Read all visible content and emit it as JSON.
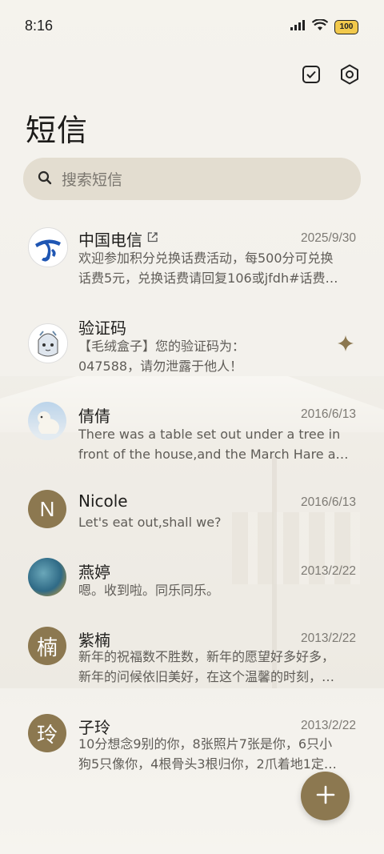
{
  "status_bar": {
    "time": "8:16",
    "battery": "100"
  },
  "header": {
    "title": "短信"
  },
  "search": {
    "placeholder": "搜索短信"
  },
  "conversations": [
    {
      "name": "中国电信",
      "date": "2025/9/30",
      "line1": "欢迎参加积分兑换话费活动，每500分可兑换",
      "line2": "话费5元，兑换话费请回复106或jfdh#话费…"
    },
    {
      "name": "验证码",
      "date": "",
      "line1": "【毛绒盒子】您的验证码为：",
      "line2": "047588，请勿泄露于他人！"
    },
    {
      "name": "倩倩",
      "date": "2016/6/13",
      "line1": "There was a table set out under a tree in",
      "line2": "front of the house,and the March Hare an…"
    },
    {
      "name": "Nicole",
      "date": "2016/6/13",
      "avatar_letter": "N",
      "line1": "Let's eat out,shall we?"
    },
    {
      "name": "燕婷",
      "date": "2013/2/22",
      "line1": "嗯。收到啦。同乐同乐。"
    },
    {
      "name": "紫楠",
      "date": "2013/2/22",
      "avatar_letter": "楠",
      "line1": "新年的祝福数不胜数，新年的愿望好多好多，",
      "line2": "新年的问候依旧美好，在这个温馨的时刻，…"
    },
    {
      "name": "子玲",
      "date": "2013/2/22",
      "avatar_letter": "玲",
      "line1": "10分想念9别的你，8张照片7张是你，6只小",
      "line2": "狗5只像你，4根骨头3根归你，2爪着地1定…"
    }
  ],
  "colors": {
    "accent": "#8c7850",
    "search_bg": "#e3ddd0",
    "telecom_blue": "#1f56b3"
  },
  "icons": {
    "status": [
      "signal-icon",
      "wifi-icon",
      "battery-icon"
    ],
    "top_actions": [
      "select-checkbox-icon",
      "settings-icon"
    ],
    "search": "search-icon",
    "pin": "star-sparkle-icon",
    "fab": "plus-icon"
  }
}
